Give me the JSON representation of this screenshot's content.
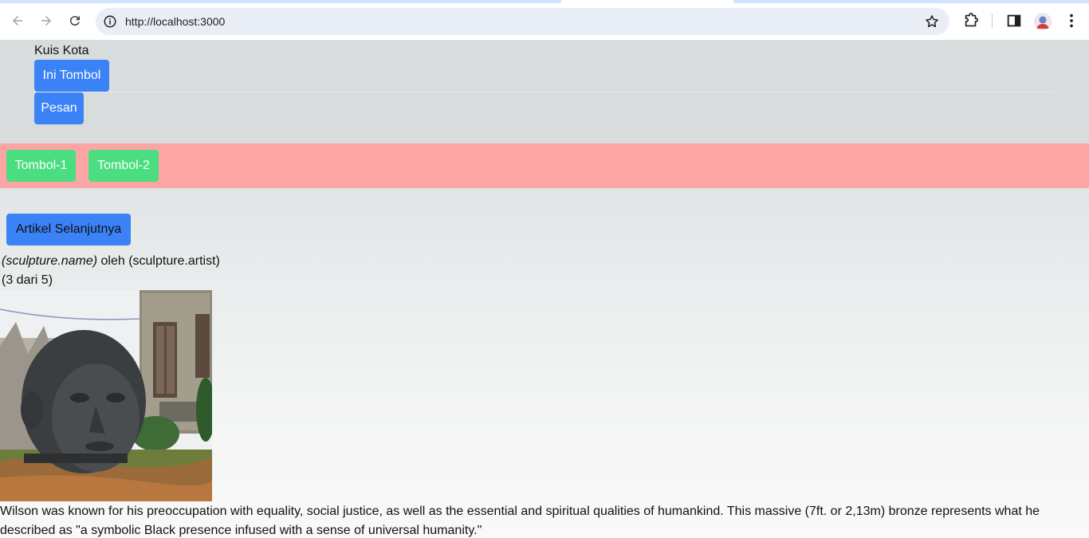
{
  "browser": {
    "url": "http://localhost:3000",
    "icons": [
      "back-icon",
      "forward-icon",
      "reload-icon",
      "site-info-icon",
      "bookmark-star-icon",
      "extensions-icon",
      "side-panel-icon",
      "profile-avatar",
      "menu-kebab-icon"
    ]
  },
  "header": {
    "title": "Kuis Kota",
    "button_primary": "Ini Tombol",
    "button_message": "Pesan"
  },
  "toolbar": {
    "button_1": "Tombol-1",
    "button_2": "Tombol-2"
  },
  "gallery": {
    "next_button": "Artikel Selanjutnya",
    "name": "(sculpture.name)",
    "by": " oleh ",
    "artist": "(sculpture.artist)",
    "counter": "(3 dari 5)",
    "description": "Wilson was known for his preoccupation with equality, social justice, as well as the essential and spiritual qualities of humankind. This massive (7ft. or 2,13m) bronze represents what he described as \"a symbolic Black presence infused with a sense of universal humanity.\""
  },
  "colors": {
    "primary_button": "#3b82f6",
    "green_button": "#4ade80",
    "red_bar": "#fca5a5",
    "header_bg": "#d8dcdd"
  }
}
